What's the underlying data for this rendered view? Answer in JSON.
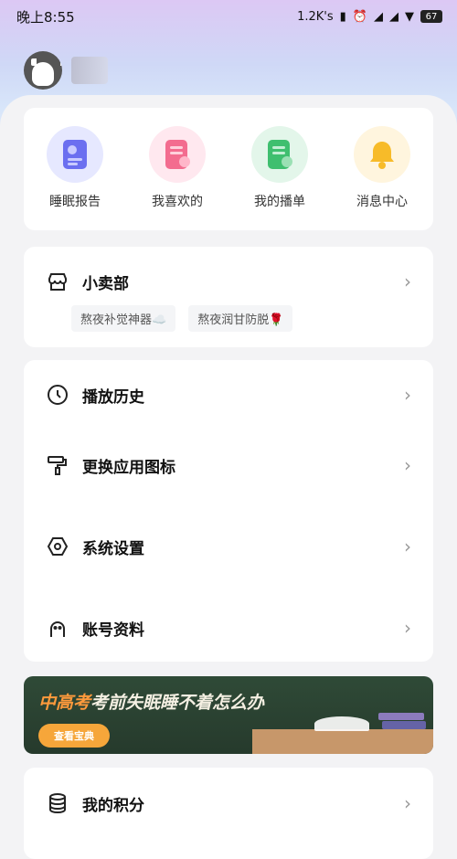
{
  "status_bar": {
    "time": "晚上8:55",
    "network_speed": "1.2K's",
    "battery": "67"
  },
  "quick_actions": [
    {
      "label": "睡眠报告",
      "icon": "sleep-report-icon",
      "bg": "#e6e8ff",
      "color": "#6b6ff0"
    },
    {
      "label": "我喜欢的",
      "icon": "favorites-icon",
      "bg": "#ffe8ef",
      "color": "#f36c8f"
    },
    {
      "label": "我的播单",
      "icon": "playlist-icon",
      "bg": "#e3f6ea",
      "color": "#3fbf6f"
    },
    {
      "label": "消息中心",
      "icon": "bell-icon",
      "bg": "#fff5de",
      "color": "#f7bb29"
    }
  ],
  "shop": {
    "label": "小卖部",
    "tags": [
      "熬夜补觉神器☁️",
      "熬夜润甘防脱🌹"
    ]
  },
  "menu": [
    {
      "label": "播放历史",
      "icon": "clock-icon"
    },
    {
      "label": "更换应用图标",
      "icon": "paint-roller-icon"
    },
    {
      "label": "系统设置",
      "icon": "settings-hex-icon"
    },
    {
      "label": "账号资料",
      "icon": "account-icon"
    }
  ],
  "banner": {
    "highlight": "中高考",
    "text": "考前失眠睡不着怎么办",
    "button": "查看宝典"
  },
  "points": {
    "label": "我的积分",
    "icon": "coins-stack-icon"
  }
}
